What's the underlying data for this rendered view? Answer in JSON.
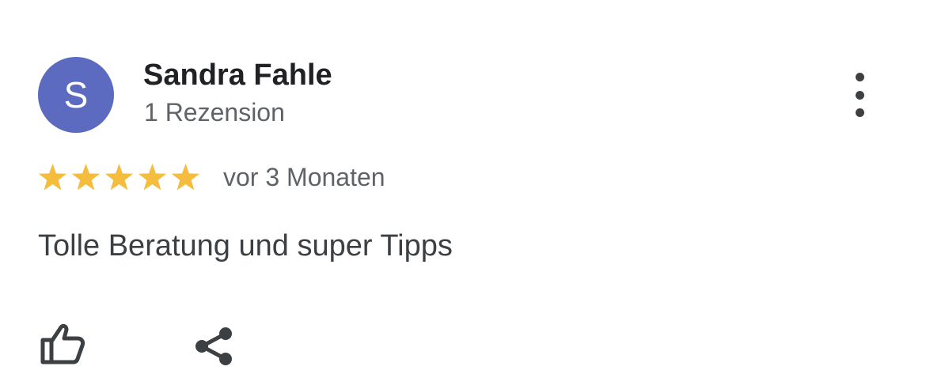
{
  "review": {
    "avatar_initial": "S",
    "author_name": "Sandra Fahle",
    "author_meta": "1 Rezension",
    "rating": 5,
    "rating_max": 5,
    "time": "vor 3 Monaten",
    "text": "Tolle Beratung und super Tipps"
  },
  "icons": {
    "more": "more-vert-icon",
    "like": "thumb-up-icon",
    "share": "share-icon",
    "star": "star-icon"
  },
  "colors": {
    "avatar_bg": "#5c6bc0",
    "star": "#f4bd3d",
    "name": "#202124",
    "secondary_text": "#5f6368",
    "body_text": "#3c4043",
    "icon": "#3c4043"
  }
}
